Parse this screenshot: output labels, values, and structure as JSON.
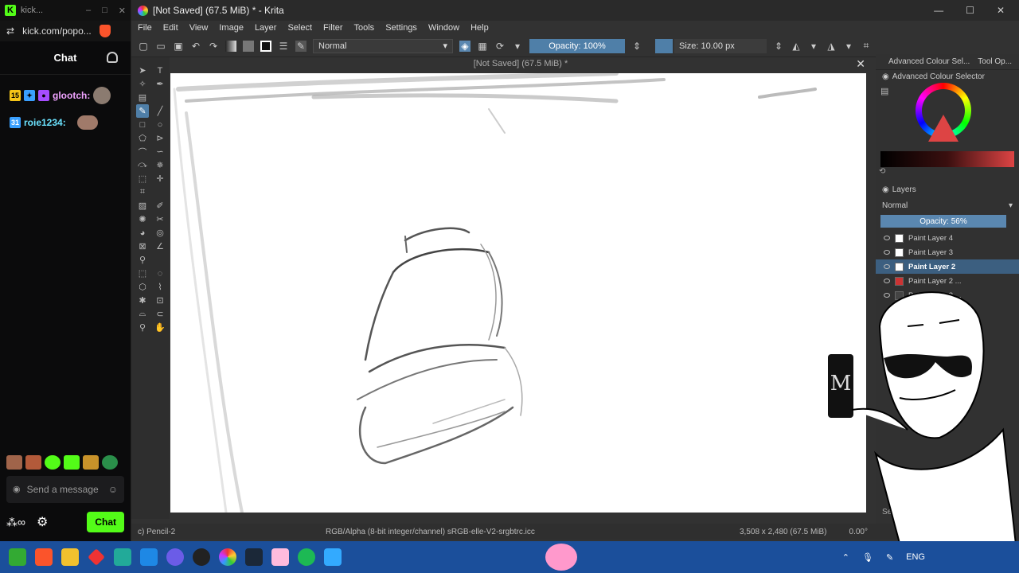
{
  "kick": {
    "tab_title": "kick...",
    "url": "kick.com/popo...",
    "chat_title": "Chat",
    "messages": [
      {
        "badge1": "15",
        "user": "glootch:",
        "color": "#f0a3ff"
      },
      {
        "badge1": "31",
        "user": "roie1234:",
        "color": "#6be3ff"
      }
    ],
    "send_placeholder": "Send a message",
    "chat_button": "Chat"
  },
  "krita": {
    "window_title": "[Not Saved]  (67.5 MiB) * - Krita",
    "menu": [
      "File",
      "Edit",
      "View",
      "Image",
      "Layer",
      "Select",
      "Filter",
      "Tools",
      "Settings",
      "Window",
      "Help"
    ],
    "blend_mode": "Normal",
    "opacity": "Opacity: 100%",
    "size": "Size: 10.00 px",
    "doc_title": "[Not Saved]  (67.5 MiB) *",
    "status": {
      "brush": "c) Pencil-2",
      "colorspace": "RGB/Alpha (8-bit integer/channel)  sRGB-elle-V2-srgbtrc.icc",
      "dimensions": "3,508 x 2,480 (67.5 MiB)",
      "rotation": "0.00°"
    },
    "dock": {
      "tabs": [
        "Advanced Colour Sel...",
        "Tool Op..."
      ],
      "colour_title": "Advanced Colour Selector",
      "layers_title": "Layers",
      "layers_blend": "Normal",
      "layers_opacity": "Opacity: 56%",
      "layers": [
        {
          "name": "Paint Layer 4",
          "selected": false
        },
        {
          "name": "Paint Layer 3",
          "selected": false
        },
        {
          "name": "Paint Layer 2",
          "selected": true
        },
        {
          "name": "Paint Layer 2 ...",
          "selected": false
        },
        {
          "name": "Paint Layer 2 ...",
          "selected": false
        }
      ],
      "search": "Search"
    }
  },
  "taskbar": {
    "lang": "ENG"
  }
}
